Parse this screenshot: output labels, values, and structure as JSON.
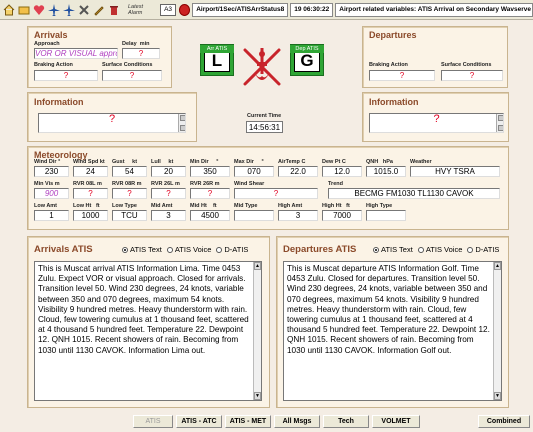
{
  "toolbar": {
    "latest_alarm_label": "Latest Alarm",
    "latest_alarm_value": "A3",
    "path": "Airport/1Sec/ATISArrStatus8",
    "datetime": "19 06:30:22",
    "status": "Airport related variables: ATIS Arrival on Secondary Wavserve fault",
    "icons": [
      "home-icon",
      "folder-icon",
      "heart-icon",
      "plane-icon",
      "plane-icon",
      "tools-icon",
      "pencil-icon",
      "trash-icon",
      "alarm-bell-icon"
    ]
  },
  "arrivals": {
    "title": "Arrivals",
    "approach_label": "Approach",
    "approach_value": "VOR OR VISUAL approach",
    "delay_label": "Delay",
    "delay_unit": "min",
    "delay_value": "?",
    "braking_label": "Braking Action",
    "braking_value": "?",
    "surface_label": "Surface Conditions",
    "surface_value": "?",
    "runway_label": "Arr ATIS",
    "runway_letter": "L"
  },
  "departures": {
    "title": "Departures",
    "runway_label": "Dep ATIS",
    "runway_letter": "G",
    "braking_label": "Braking Action",
    "braking_value": "?",
    "surface_label": "Surface Conditions",
    "surface_value": "?"
  },
  "info_left": {
    "title": "Information",
    "value": "?"
  },
  "info_right": {
    "title": "Information",
    "value": "?"
  },
  "current_time": {
    "label": "Current Time",
    "value": "14:56:31"
  },
  "meteorology": {
    "title": "Meteorology",
    "row1": [
      {
        "label": "Wind Dir",
        "unit": "°",
        "value": "230"
      },
      {
        "label": "Wind Spd",
        "unit": "kt",
        "value": "24"
      },
      {
        "label": "Gust",
        "unit": "kt",
        "value": "54"
      },
      {
        "label": "Lull",
        "unit": "kt",
        "value": "20"
      },
      {
        "label": "Min Dir",
        "unit": "°",
        "value": "350"
      },
      {
        "label": "Max Dir",
        "unit": "°",
        "value": "070"
      },
      {
        "label": "AirTemp",
        "unit": "C",
        "value": "22.0"
      },
      {
        "label": "Dew Pt",
        "unit": "C",
        "value": "12.0"
      },
      {
        "label": "QNH",
        "unit": "hPa",
        "value": "1015.0"
      },
      {
        "label": "Weather",
        "unit": "",
        "value": "HVY TSRA"
      }
    ],
    "row2": [
      {
        "label": "Min Vis",
        "unit": "m",
        "value": "900"
      },
      {
        "label": "RVR 08L",
        "unit": "m",
        "value": "?"
      },
      {
        "label": "RVR 08R",
        "unit": "m",
        "value": "?"
      },
      {
        "label": "RVR 26L",
        "unit": "m",
        "value": "?"
      },
      {
        "label": "RVR 26R",
        "unit": "m",
        "value": "?"
      },
      {
        "label": "Wind Shear",
        "unit": "",
        "value": "?"
      },
      {
        "label": "Trend",
        "unit": "",
        "value": "BECMG FM1030 TL1130 CAVOK"
      }
    ],
    "row3": [
      {
        "label": "Low Amt",
        "unit": "",
        "value": "1"
      },
      {
        "label": "Low Ht",
        "unit": "ft",
        "value": "1000"
      },
      {
        "label": "Low Type",
        "unit": "",
        "value": "TCU"
      },
      {
        "label": "Mid Amt",
        "unit": "",
        "value": "3"
      },
      {
        "label": "Mid Ht",
        "unit": "ft",
        "value": "4500"
      },
      {
        "label": "Mid Type",
        "unit": "",
        "value": ""
      },
      {
        "label": "High Amt",
        "unit": "",
        "value": "3"
      },
      {
        "label": "High Ht",
        "unit": "ft",
        "value": "7000"
      },
      {
        "label": "High Type",
        "unit": "",
        "value": ""
      }
    ]
  },
  "arr_atis": {
    "title": "Arrivals ATIS",
    "options": [
      "ATIS Text",
      "ATIS Voice",
      "D-ATIS"
    ],
    "selected": 0,
    "text": "This is Muscat arrival ATIS Information Lima. Time 0453 Zulu. Expect VOR or visual approach. Closed for arrivals. Transition level 50. Wind 230 degrees, 24 knots, variable between 350 and 070 degrees, maximum 54 knots. Visibility 9 hundred metres. Heavy thunderstorm with rain. Cloud, few towering cumulus at 1 thousand feet, scattered at 4 thousand 5 hundred feet. Temperature 22. Dewpoint 12. QNH 1015. Recent showers of rain. Becoming from 1030 until 1130 CAVOK. Information Lima out."
  },
  "dep_atis": {
    "title": "Departures ATIS",
    "options": [
      "ATIS Text",
      "ATIS Voice",
      "D-ATIS"
    ],
    "selected": 0,
    "text": "This is Muscat departure ATIS Information Golf. Time 0453 Zulu. Closed for departures. Transition level 50. Wind 230 degrees, 24 knots, variable between 350 and 070 degrees, maximum 54 knots. Visibility 9 hundred metres. Heavy thunderstorm with rain. Cloud, few towering cumulus at 1 thousand feet, scattered at 4 thousand 5 hundred feet. Temperature 22. Dewpoint 12. QNH 1015. Recent showers of rain. Becoming from 1030 until 1130 CAVOK. Information Golf out."
  },
  "bottom_buttons": [
    {
      "label": "ATIS",
      "enabled": false
    },
    {
      "label": "ATIS - ATC",
      "enabled": true
    },
    {
      "label": "ATIS - MET",
      "enabled": true
    },
    {
      "label": "All Msgs",
      "enabled": true
    },
    {
      "label": "Tech",
      "enabled": true
    },
    {
      "label": "VOLMET",
      "enabled": true
    },
    {
      "label": "Combined",
      "enabled": true
    }
  ],
  "colors": {
    "panel_bg": "#fbf3e6",
    "title_brown": "#8b4a2a",
    "runway_green": "#2fa535",
    "value_red": "#e00020",
    "value_purple": "#b040c0",
    "emblem_red": "#c8242b"
  }
}
